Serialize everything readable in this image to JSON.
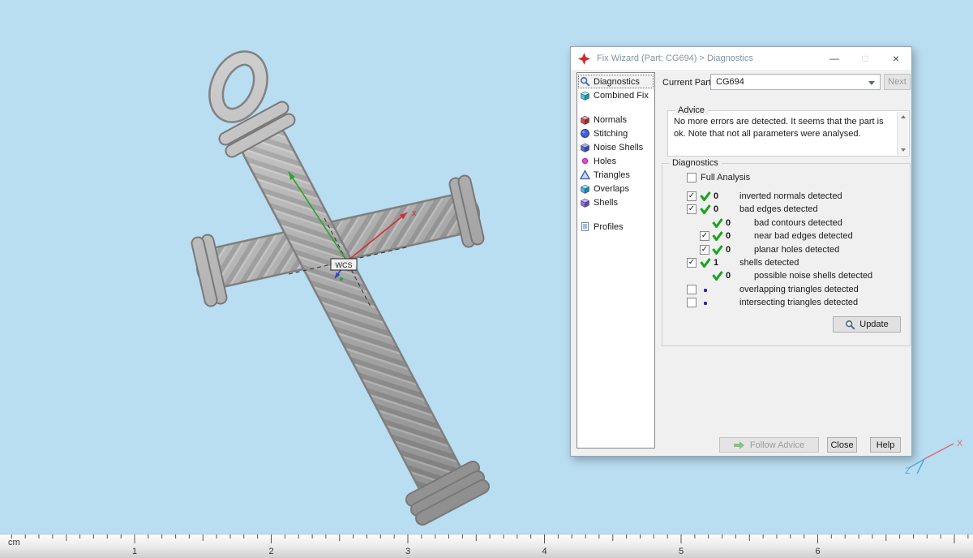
{
  "window": {
    "title": "Fix Wizard (Part: CG694) > Diagnostics",
    "controls": {
      "minimize": "—",
      "maximize": "□",
      "close": "×"
    }
  },
  "dialog": {
    "current_part_label": "Current Part:",
    "current_part_value": "CG694",
    "next_button": "Next",
    "sidebar": {
      "items": [
        {
          "label": "Diagnostics",
          "icon": "magnifier",
          "selected": true
        },
        {
          "label": "Combined Fix",
          "icon": "combined-fix"
        },
        {
          "label": "Normals",
          "icon": "normals",
          "gap_before": true
        },
        {
          "label": "Stitching",
          "icon": "stitching"
        },
        {
          "label": "Noise Shells",
          "icon": "noise-shells"
        },
        {
          "label": "Holes",
          "icon": "holes"
        },
        {
          "label": "Triangles",
          "icon": "triangles"
        },
        {
          "label": "Overlaps",
          "icon": "overlaps"
        },
        {
          "label": "Shells",
          "icon": "shells"
        },
        {
          "label": "Profiles",
          "icon": "profiles",
          "gap_before": true
        }
      ]
    },
    "advice": {
      "group_label": "Advice",
      "text": "No more errors are detected. It seems that the part is ok. Note that not all parameters were analysed."
    },
    "diagnostics": {
      "group_label": "Diagnostics",
      "full_analysis_label": "Full Analysis",
      "full_analysis_checked": false,
      "rows": [
        {
          "has_checkbox": true,
          "checked": true,
          "status": "check",
          "count": "0",
          "label": "inverted normals detected",
          "indent": 0
        },
        {
          "has_checkbox": true,
          "checked": true,
          "status": "check",
          "count": "0",
          "label": "bad edges detected",
          "indent": 0
        },
        {
          "has_checkbox": false,
          "checked": false,
          "status": "check",
          "count": "0",
          "label": "bad contours detected",
          "indent": 1
        },
        {
          "has_checkbox": true,
          "checked": true,
          "status": "check",
          "count": "0",
          "label": "near bad edges detected",
          "indent": 1
        },
        {
          "has_checkbox": true,
          "checked": true,
          "status": "check",
          "count": "0",
          "label": "planar holes detected",
          "indent": 1
        },
        {
          "has_checkbox": true,
          "checked": true,
          "status": "check",
          "count": "1",
          "label": "shells detected",
          "indent": 0
        },
        {
          "has_checkbox": false,
          "checked": false,
          "status": "check",
          "count": "0",
          "label": "possible noise shells detected",
          "indent": 1
        },
        {
          "has_checkbox": true,
          "checked": false,
          "status": "dot",
          "count": "",
          "label": "overlapping triangles detected",
          "indent": 0
        },
        {
          "has_checkbox": true,
          "checked": false,
          "status": "dot",
          "count": "",
          "label": "intersecting triangles detected",
          "indent": 0
        }
      ],
      "update_button": "Update"
    },
    "footer": {
      "follow_advice": "Follow Advice",
      "close": "Close",
      "help": "Help"
    }
  },
  "viewport": {
    "wcs_label": "WCS",
    "axis_x_label": "x"
  },
  "corner_axes": {
    "x_label": "X",
    "z_label": "Z"
  },
  "ruler": {
    "unit": "cm",
    "ticks": [
      "1",
      "2",
      "3",
      "4",
      "5",
      "6"
    ]
  },
  "colors": {
    "background": "#b9ddf1",
    "model_gray": "#a6a6a6",
    "check_green": "#1ca21c",
    "axis_red": "#d03030",
    "axis_green": "#28a428",
    "axis_blue": "#3048c0"
  }
}
